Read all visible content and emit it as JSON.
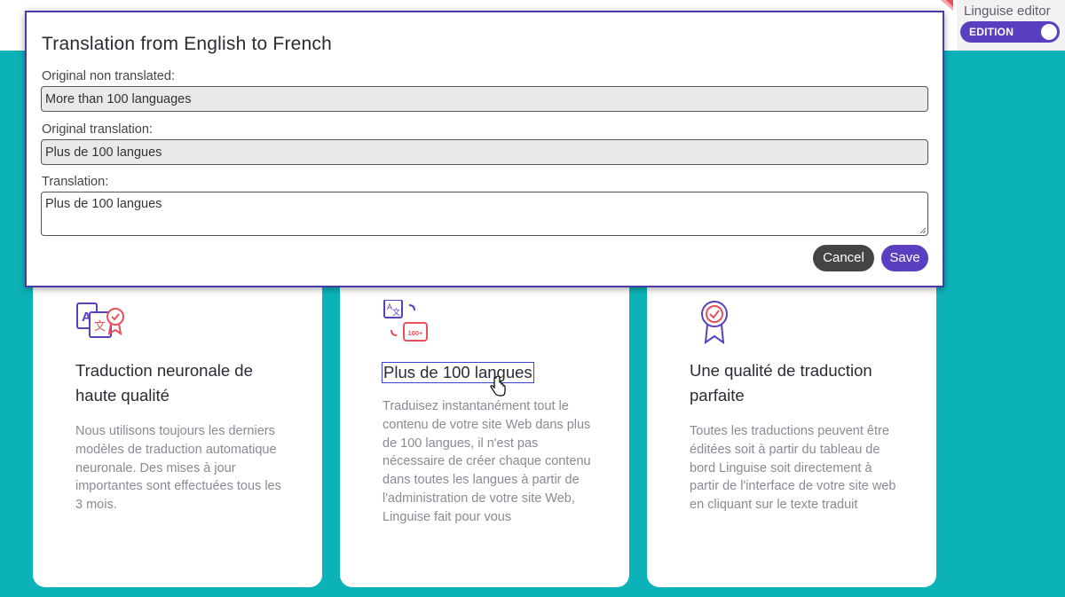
{
  "editor_widget": {
    "title": "Linguise editor",
    "toggle_label": "EDITION",
    "toggle_on": true
  },
  "modal": {
    "title": "Translation from English to French",
    "original_label": "Original non translated:",
    "original_value": "More than 100 languages",
    "orig_translation_label": "Original translation:",
    "orig_translation_value": "Plus de 100 langues",
    "translation_label": "Translation:",
    "translation_value": "Plus de 100 langues",
    "cancel_label": "Cancel",
    "save_label": "Save"
  },
  "cards": [
    {
      "icon": "translate-quality-icon",
      "heading": "Traduction neuronale de haute qualité",
      "body": "Nous utilisons toujours les derniers modèles de traduction automatique neuronale. Des mises à jour importantes sont effectuées tous les 3 mois."
    },
    {
      "icon": "languages-100-icon",
      "icon_badge": "100+",
      "heading": "Plus de 100 langues",
      "body": "Traduisez instantanément tout le contenu de votre site Web dans plus de 100 langues, il n'est pas nécessaire de créer chaque contenu dans toutes les langues à partir de l'administration de votre site Web, Linguise fait pour vous"
    },
    {
      "icon": "award-ribbon-icon",
      "heading": "Une qualité de traduction parfaite",
      "body": "Toutes les traductions peuvent être éditées soit à partir du tableau de bord Linguise soit directement à partir de l'interface de votre site web en cliquant sur le texte traduit"
    }
  ],
  "colors": {
    "teal": "#0bb3b8",
    "purple": "#5a3fc0",
    "icon_red": "#e8505b",
    "icon_purple": "#5a3fc0"
  }
}
